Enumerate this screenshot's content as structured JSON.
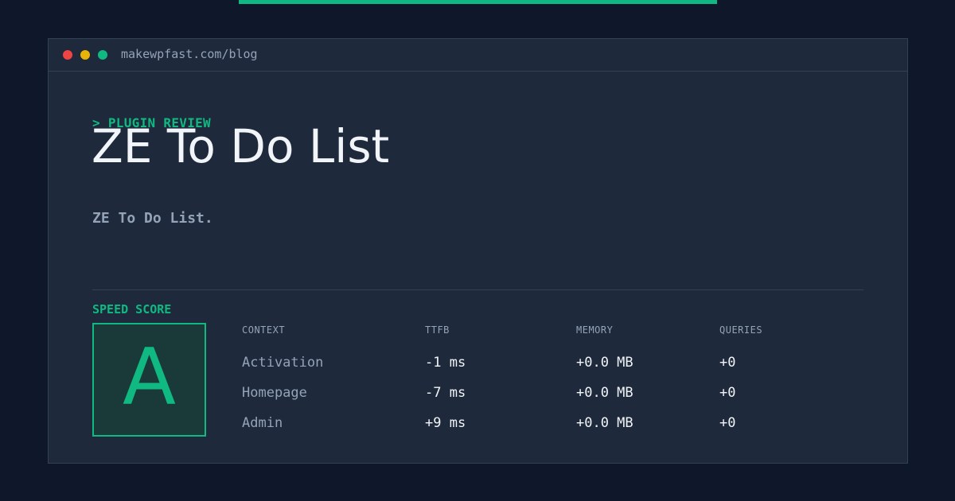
{
  "browser": {
    "url": "makewpfast.com/blog",
    "dots": [
      "red",
      "yellow",
      "green"
    ]
  },
  "post": {
    "eyebrow": "> PLUGIN REVIEW",
    "title": "ZE To Do List",
    "subtitle": "ZE To Do List."
  },
  "speed": {
    "label": "SPEED SCORE",
    "grade": "A"
  },
  "table": {
    "headers": [
      "CONTEXT",
      "TTFB",
      "MEMORY",
      "QUERIES"
    ],
    "rows": [
      {
        "context": "Activation",
        "ttfb": "-1 ms",
        "memory": "+0.0 MB",
        "queries": "+0"
      },
      {
        "context": "Homepage",
        "ttfb": "-7 ms",
        "memory": "+0.0 MB",
        "queries": "+0"
      },
      {
        "context": "Admin",
        "ttfb": "+9 ms",
        "memory": "+0.0 MB",
        "queries": "+0"
      }
    ]
  },
  "colors": {
    "background": "#0f172a",
    "panel": "#1e293b",
    "border": "#334155",
    "accent": "#10b981",
    "text_primary": "#f1f5f9",
    "text_muted": "#94a3b8"
  }
}
